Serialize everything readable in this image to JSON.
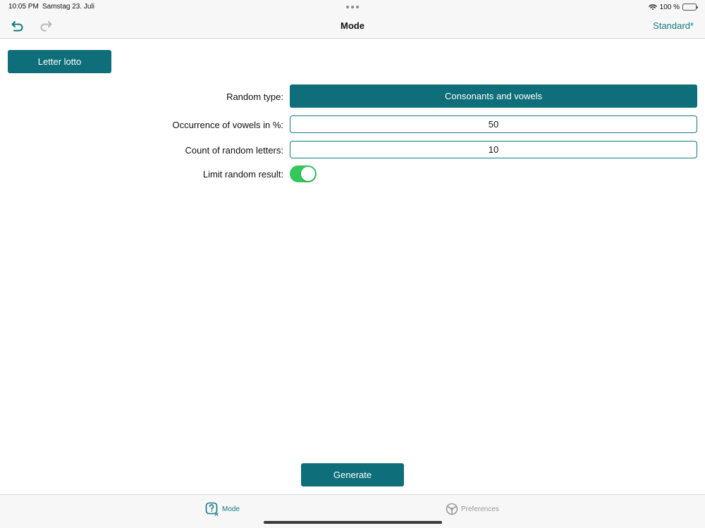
{
  "status_bar": {
    "time": "10:05 PM",
    "date": "Samstag 23. Juli",
    "battery_text": "100 %",
    "icons": [
      "wifi-icon",
      "battery-icon"
    ]
  },
  "nav": {
    "title": "Mode",
    "right_label": "Standard*",
    "icons": [
      "undo-icon",
      "redo-icon"
    ]
  },
  "mode_button_label": "Letter lotto",
  "form": {
    "random_type_label": "Random type:",
    "random_type_value": "Consonants and vowels",
    "vowels_label": "Occurrence of vowels in %:",
    "vowels_value": "50",
    "count_label": "Count of random letters:",
    "count_value": "10",
    "limit_label": "Limit random result:",
    "limit_enabled": true
  },
  "generate_label": "Generate",
  "tabs": [
    {
      "label": "Mode",
      "icon": "mode-icon",
      "active": true
    },
    {
      "label": "Preferences",
      "icon": "preferences-icon",
      "active": false
    }
  ],
  "colors": {
    "accent": "#0e6e79",
    "accent_text": "#127a82",
    "toggle_on": "#34c759"
  }
}
